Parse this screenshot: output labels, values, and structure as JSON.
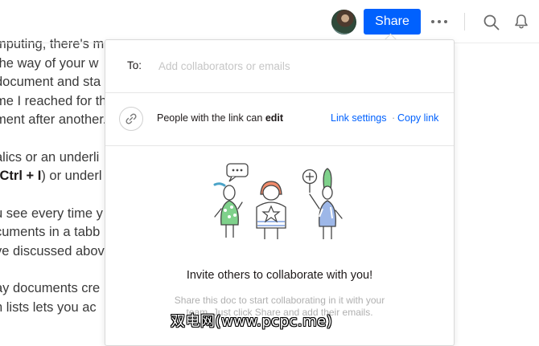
{
  "document": {
    "lines": [
      "mputing, there's m",
      "the way of your w",
      "document and sta",
      "me I reached for th",
      "ment after another.",
      "",
      "alics or an underli",
      "Ctrl + I) or underl",
      "",
      "u see every time y",
      "cuments in a tabb",
      "ve discussed abov",
      "",
      "ay documents cre",
      "n lists lets you ac"
    ],
    "bold_keys": "Ctrl + I"
  },
  "topbar": {
    "share_label": "Share"
  },
  "share_panel": {
    "to_label": "To:",
    "to_placeholder": "Add collaborators or emails",
    "link_prefix": "People with the link can ",
    "link_permission": "edit",
    "link_settings_label": "Link settings",
    "link_separator": "·",
    "copy_link_label": "Copy link",
    "invite_title": "Invite others to collaborate with you!",
    "invite_description": "Share this doc to start collaborating in it with your team. Just click Share and add their emails."
  },
  "watermark": "双电网(www.pcpc.me)",
  "colors": {
    "accent": "#0061fe",
    "text": "#1e1919",
    "muted": "#b0b0b0",
    "divider": "#e6e6e6"
  }
}
